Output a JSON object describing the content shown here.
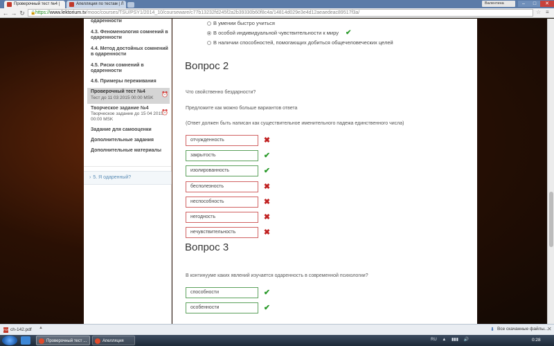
{
  "browser": {
    "tabs": [
      {
        "label": "Проверочный тест №4 | "
      },
      {
        "label": "Апелляция по тестам | Л"
      }
    ],
    "user_badge": "Валентина",
    "url": {
      "scheme": "https://",
      "host": "www.lektorium.tv",
      "path": "/mooc/courses/TSU/PSY1/2014_10/courseware/c77b13232fd245f2a2b39330b60f8c4a/14814d029e3e4d12aeaedeac89517f3a/"
    }
  },
  "sidebar": {
    "items": [
      {
        "label": "одаренности"
      },
      {
        "label": "4.3. Феноменология сомнений в одаренности"
      },
      {
        "label": "4.4. Метод достойных сомнений в одаренности"
      },
      {
        "label": "4.5. Риски сомнений в одаренности"
      },
      {
        "label": "4.6. Примеры переживания"
      }
    ],
    "active": {
      "title": "Проверочный тест №4",
      "subtitle": "Тест до 11 03 2015 00:00 MSK"
    },
    "creative": {
      "title": "Творческое задание №4",
      "subtitle": "Творческое задание до 15 04 2015 00:00 MSK"
    },
    "extra": [
      {
        "label": "Задание для самооценки"
      },
      {
        "label": "Дополнительные задания"
      },
      {
        "label": "Дополнительные материалы"
      }
    ],
    "module": "5. Я одаренный?"
  },
  "question1": {
    "options": [
      {
        "label": "В умении быстро учиться",
        "checked": false
      },
      {
        "label": "В особой индивидуальной чувствительности к миру",
        "checked": true
      },
      {
        "label": "В наличии способностей, помогающих добиться общечеловеческих целей",
        "checked": false
      }
    ]
  },
  "question2": {
    "title": "Вопрос 2",
    "text": "Что свойственно бездарности?",
    "hint": "Предложите как можно больше вариантов ответа",
    "note": "(Ответ должен быть написан как существительное именительного падежа единственного числа)",
    "answers": [
      {
        "value": "отчужденность",
        "correct": false
      },
      {
        "value": "закрытость",
        "correct": true
      },
      {
        "value": "изолированность",
        "correct": true
      },
      {
        "value": "бесполезность",
        "correct": false
      },
      {
        "value": "неспособность",
        "correct": false
      },
      {
        "value": "негодность",
        "correct": false
      },
      {
        "value": "нечувствительность",
        "correct": false
      }
    ]
  },
  "question3": {
    "title": "Вопрос 3",
    "text": "В континууме каких явлений изучается одаренность в современной психологии?",
    "answers": [
      {
        "value": "способности",
        "correct": true
      },
      {
        "value": "особенности",
        "correct": true
      }
    ]
  },
  "downloads": {
    "file": "ch-142.pdf",
    "show_all": "Все скачанные файлы..."
  },
  "taskbar": {
    "apps": [
      {
        "label": "Проверочный тест ..."
      },
      {
        "label": "Апелляция"
      }
    ],
    "lang": "RU",
    "time": "0:28"
  }
}
